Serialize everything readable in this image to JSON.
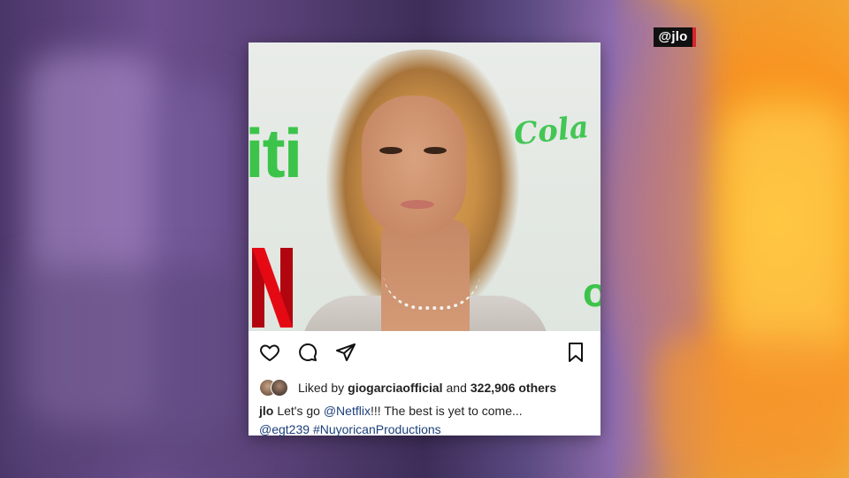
{
  "overlay": {
    "handle_tag": "@jlo"
  },
  "post": {
    "photo": {
      "sponsor_texts": [
        "iti",
        "Cola",
        "o"
      ],
      "brand_logo": "netflix-n-logo"
    },
    "actions": {
      "like": "heart-icon",
      "comment": "comment-icon",
      "share": "send-icon",
      "save": "bookmark-icon"
    },
    "likes": {
      "prefix": "Liked by",
      "user": "giogarciaofficial",
      "and": "and",
      "count": "322,906 others"
    },
    "caption": {
      "user": "jlo",
      "text_1": "Let's go",
      "mention_1": "@Netflix",
      "text_2": "!!! The best is yet to come...",
      "mention_2": "@egt239",
      "hashtag": "#NuyoricanProductions"
    }
  },
  "colors": {
    "link": "#1b3f7a",
    "netflix_red": "#e50914",
    "tag_accent": "#d7262b"
  }
}
